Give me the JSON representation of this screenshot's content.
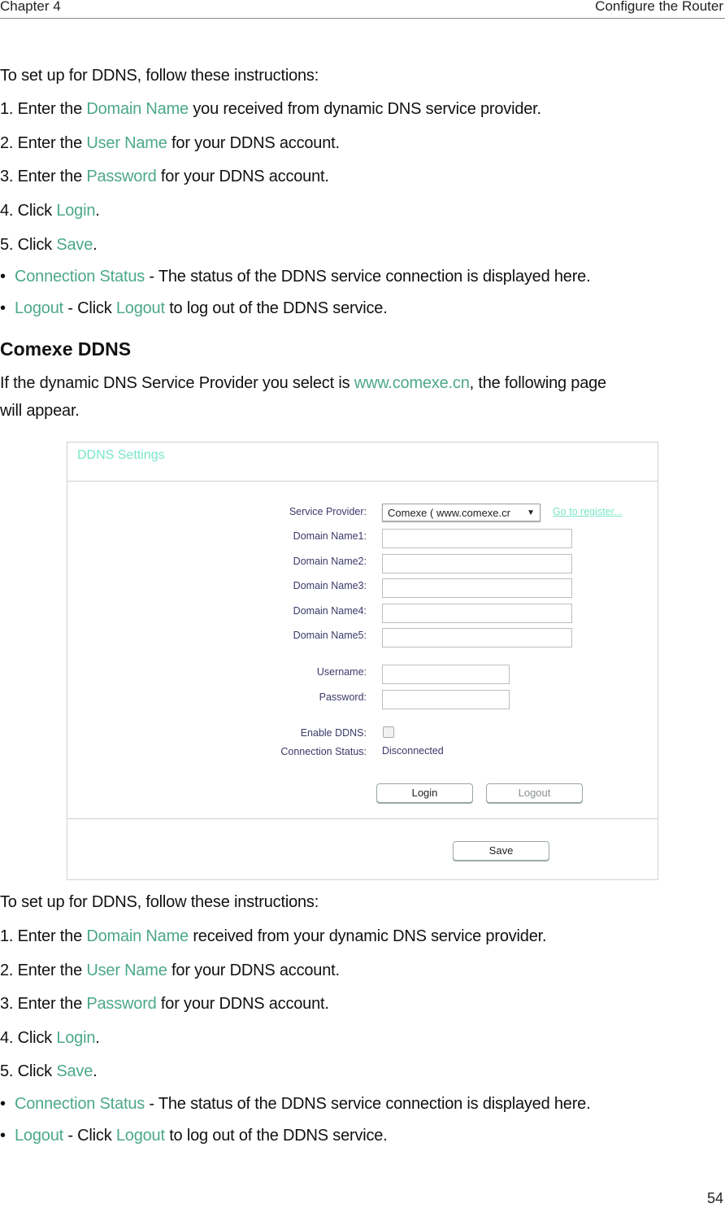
{
  "header": {
    "chapter": "Chapter 4",
    "section": "Configure the Router"
  },
  "intro1": {
    "lead": "To set up for DDNS, follow these instructions:",
    "steps": [
      {
        "pre": "1. Enter the ",
        "hl": "Domain Name",
        "post": " you received from dynamic DNS service provider."
      },
      {
        "pre": "2. Enter the ",
        "hl": "User Name",
        "post": " for your DDNS account."
      },
      {
        "pre": "3. Enter the ",
        "hl": "Password",
        "post": " for your DDNS account."
      },
      {
        "pre": "4. Click ",
        "hl": "Login",
        "post": "."
      },
      {
        "pre": "5. Click ",
        "hl": "Save",
        "post": "."
      }
    ],
    "bullets": [
      {
        "hl": "Connection Status",
        "mid": " - The status of the DDNS service connection is displayed here.",
        "hl2": "",
        "post": ""
      },
      {
        "hl": "Logout",
        "mid": " - Click ",
        "hl2": "Logout",
        "post": " to log out of the DDNS service."
      }
    ]
  },
  "section": {
    "title": "Comexe DDNS",
    "para_pre": "If the dynamic DNS Service Provider you select is ",
    "para_link": "www.comexe.cn",
    "para_post": ", the following page",
    "para_line2": "will appear."
  },
  "screenshot": {
    "title": "DDNS Settings",
    "service_provider_label": "Service Provider:",
    "service_provider_value": "Comexe ( www.comexe.cr",
    "register_link": "Go to register...",
    "domain_labels": [
      "Domain Name1:",
      "Domain Name2:",
      "Domain Name3:",
      "Domain Name4:",
      "Domain Name5:"
    ],
    "domain_values": [
      "",
      "",
      "",
      "",
      ""
    ],
    "username_label": "Username:",
    "username_value": "",
    "password_label": "Password:",
    "password_value": "",
    "enable_label": "Enable DDNS:",
    "enable_checked": false,
    "status_label": "Connection Status:",
    "status_value": "Disconnected",
    "login_button": "Login",
    "logout_button": "Logout",
    "save_button": "Save"
  },
  "intro2": {
    "lead": "To set up for DDNS, follow these instructions:",
    "steps": [
      {
        "pre": "1. Enter the ",
        "hl": "Domain Name",
        "post": " received from your dynamic DNS service provider."
      },
      {
        "pre": "2. Enter the ",
        "hl": "User Name",
        "post": " for your DDNS account."
      },
      {
        "pre": "3. Enter the ",
        "hl": "Password",
        "post": " for your DDNS account."
      },
      {
        "pre": "4. Click ",
        "hl": "Login",
        "post": "."
      },
      {
        "pre": "5. Click ",
        "hl": "Save",
        "post": "."
      }
    ],
    "bullets": [
      {
        "hl": "Connection Status",
        "mid": " - The status of the DDNS service connection is displayed here.",
        "hl2": "",
        "post": ""
      },
      {
        "hl": "Logout",
        "mid": " - Click ",
        "hl2": "Logout",
        "post": " to log out of the DDNS service."
      }
    ]
  },
  "page_number": "54",
  "colors": {
    "highlight": "#4ca88a",
    "ui_accent": "#78e6c8"
  }
}
